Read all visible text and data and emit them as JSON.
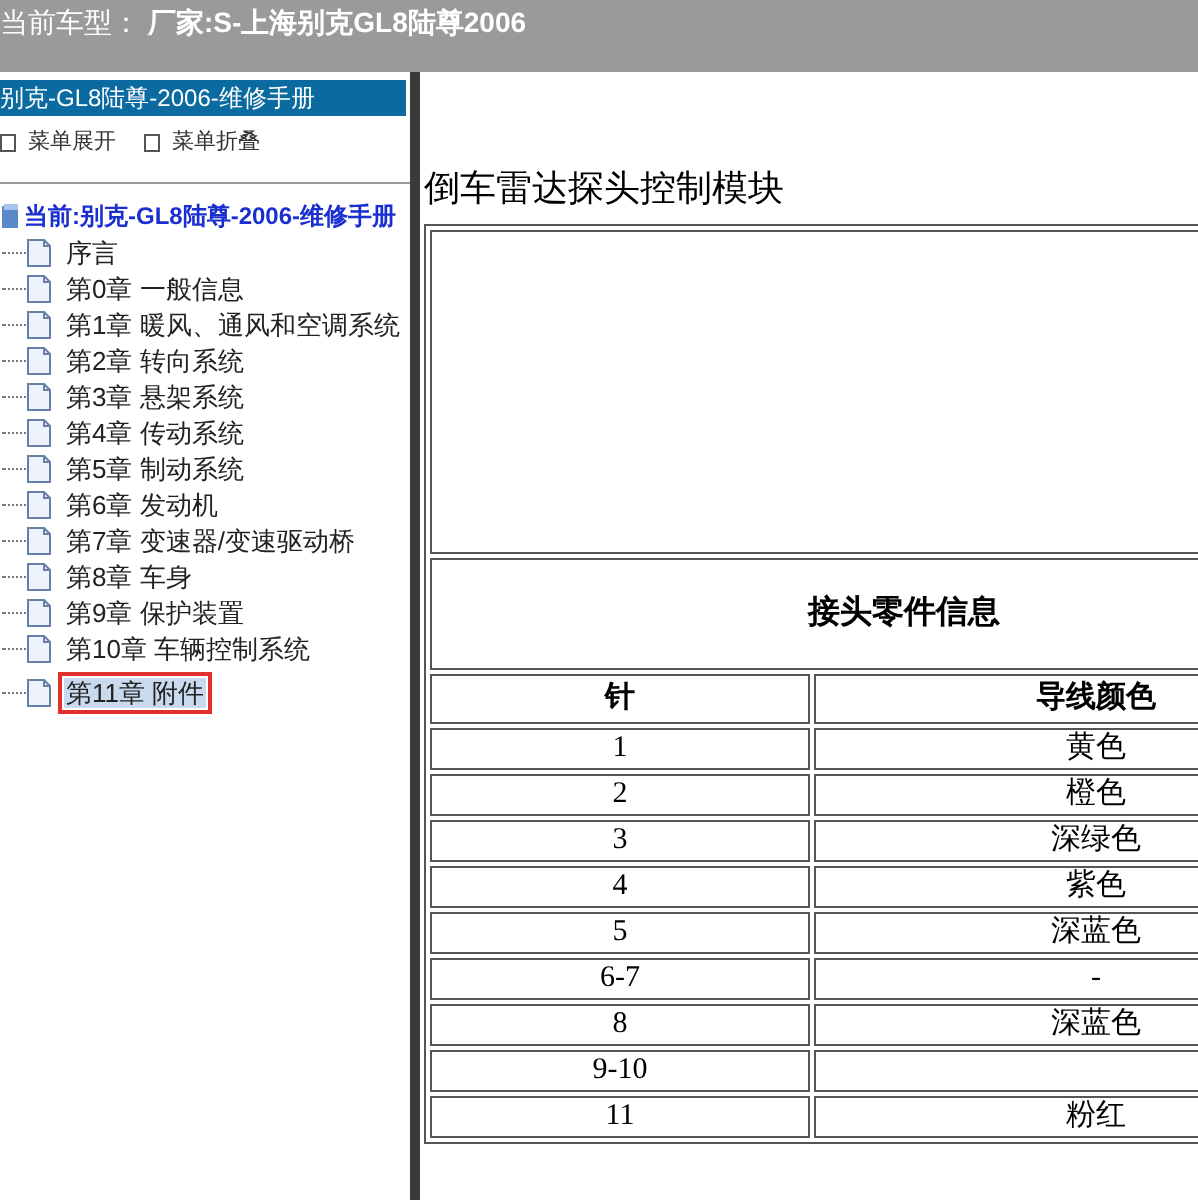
{
  "top_bar": {
    "label": "当前车型：",
    "value": "厂家:S-上海别克GL8陆尊2006"
  },
  "sidebar": {
    "title": "别克-GL8陆尊-2006-维修手册",
    "menu": [
      "菜单展开",
      "菜单折叠"
    ],
    "root": "当前:别克-GL8陆尊-2006-维修手册",
    "items": [
      {
        "label": "序言",
        "selected": false
      },
      {
        "label": "第0章 一般信息",
        "selected": false
      },
      {
        "label": "第1章 暖风、通风和空调系统",
        "selected": false
      },
      {
        "label": "第2章 转向系统",
        "selected": false
      },
      {
        "label": "第3章 悬架系统",
        "selected": false
      },
      {
        "label": "第4章 传动系统",
        "selected": false
      },
      {
        "label": "第5章 制动系统",
        "selected": false
      },
      {
        "label": "第6章 发动机",
        "selected": false
      },
      {
        "label": "第7章 变速器/变速驱动桥",
        "selected": false
      },
      {
        "label": "第8章 车身",
        "selected": false
      },
      {
        "label": "第9章 保护装置",
        "selected": false
      },
      {
        "label": "第10章 车辆控制系统",
        "selected": false
      },
      {
        "label": "第11章 附件",
        "selected": true
      }
    ]
  },
  "content": {
    "title": "倒车雷达探头控制模块",
    "table": {
      "caption": "接头零件信息",
      "columns": [
        "针",
        "导线颜色"
      ],
      "rows": [
        [
          "1",
          "黄色"
        ],
        [
          "2",
          "橙色"
        ],
        [
          "3",
          "深绿色"
        ],
        [
          "4",
          "紫色"
        ],
        [
          "5",
          "深蓝色"
        ],
        [
          "6-7",
          "-"
        ],
        [
          "8",
          "深蓝色"
        ],
        [
          "9-10",
          ""
        ],
        [
          "11",
          "粉红"
        ]
      ]
    }
  }
}
